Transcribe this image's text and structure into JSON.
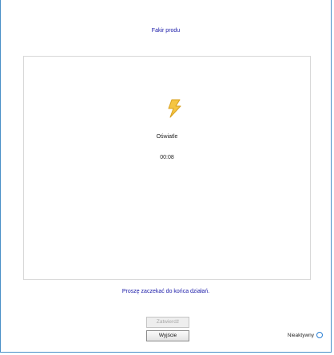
{
  "header": {
    "link_text": "Fakir produ"
  },
  "main": {
    "icon": "lightning-bolt-icon",
    "status_label": "Oświatle",
    "timer": "00:08"
  },
  "info": {
    "text": "Proszę zaczekać do końca działań."
  },
  "buttons": {
    "disabled_label": "Zatwierdź",
    "exit_label": "Wyjście"
  },
  "status": {
    "label": "Nieaktywny",
    "indicator_icon": "status-ring-icon",
    "indicator_color": "#2a7fd4"
  },
  "colors": {
    "accent": "#1a1aa8",
    "window_border": "#4a90c8",
    "bolt_fill": "#f5c542"
  }
}
